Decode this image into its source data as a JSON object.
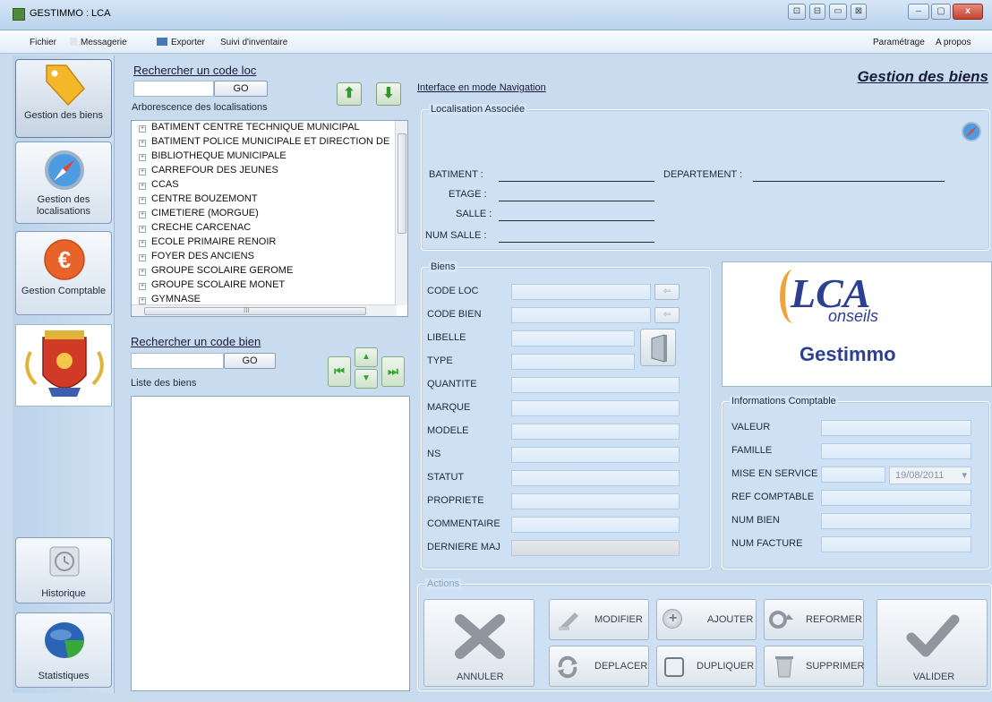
{
  "window": {
    "title": "GESTIMMO : LCA",
    "buttons": [
      "⊡",
      "⊟",
      "▭",
      "⊠",
      "–",
      "▢",
      "x"
    ]
  },
  "menu": {
    "left": [
      "Fichier",
      "Messagerie",
      "Exporter",
      "Suivi d'inventaire"
    ],
    "right": [
      "Paramétrage",
      "A propos"
    ]
  },
  "nav": {
    "items": [
      {
        "label": "Gestion des biens",
        "icon": "tag-icon"
      },
      {
        "label": "Gestion des localisations",
        "icon": "compass-icon"
      },
      {
        "label": "Gestion Comptable",
        "icon": "euro-icon"
      },
      {
        "label": "Historique",
        "icon": "history-icon"
      },
      {
        "label": "Statistiques",
        "icon": "chart-icon"
      }
    ]
  },
  "search_loc": {
    "title": "Rechercher un code loc",
    "value": "",
    "go": "GO"
  },
  "tree": {
    "title": "Arborescence des localisations",
    "items": [
      "BATIMENT CENTRE TECHNIQUE MUNICIPAL",
      "BATIMENT POLICE MUNICIPALE ET DIRECTION DE",
      "BIBLIOTHEQUE MUNICIPALE",
      "CARREFOUR DES JEUNES",
      "CCAS",
      "CENTRE BOUZEMONT",
      "CIMETIERE (MORGUE)",
      "CRECHE CARCENAC",
      "ECOLE PRIMAIRE RENOIR",
      "FOYER DES ANCIENS",
      "GROUPE SCOLAIRE GEROME",
      "GROUPE SCOLAIRE MONET",
      "GYMNASE"
    ],
    "hscroll_dots": "III"
  },
  "search_bien": {
    "title": "Rechercher un code bien",
    "value": "",
    "go": "GO",
    "list_title": "Liste des biens"
  },
  "header": {
    "mode_link": "Interface en mode Navigation",
    "page_title": "Gestion des biens"
  },
  "localisation": {
    "title": "Localisation Associée",
    "fields": [
      {
        "label": "BATIMENT :",
        "value": ""
      },
      {
        "label": "ETAGE :",
        "value": ""
      },
      {
        "label": "SALLE :",
        "value": ""
      },
      {
        "label": "NUM SALLE :",
        "value": ""
      }
    ],
    "departement": {
      "label": "DEPARTEMENT :",
      "value": ""
    }
  },
  "biens": {
    "title": "Biens",
    "fields": [
      "CODE LOC",
      "CODE BIEN",
      "LIBELLE",
      "TYPE",
      "QUANTITE",
      "MARQUE",
      "MODELE",
      "NS",
      "STATUT",
      "PROPRIETE",
      "COMMENTAIRE",
      "DERNIERE MAJ"
    ],
    "mini_btn": "⇦"
  },
  "logo": {
    "big": "LCA",
    "sub": "onseils",
    "brand": "Gestimmo"
  },
  "compta": {
    "title": "Informations Comptable",
    "fields": [
      "VALEUR",
      "FAMILLE",
      "MISE EN SERVICE",
      "REF COMPTABLE",
      "NUM BIEN",
      "NUM FACTURE"
    ],
    "date_value": "19/08/2011",
    "date_caret": "▾"
  },
  "actions": {
    "title": "Actions",
    "annuler": "ANNULER",
    "valider": "VALIDER",
    "modifier": "MODIFIER",
    "ajouter": "AJOUTER",
    "reformer": "REFORMER",
    "deplacer": "DEPLACER",
    "dupliquer": "DUPLIQUER",
    "supprimer": "SUPPRIMER"
  }
}
